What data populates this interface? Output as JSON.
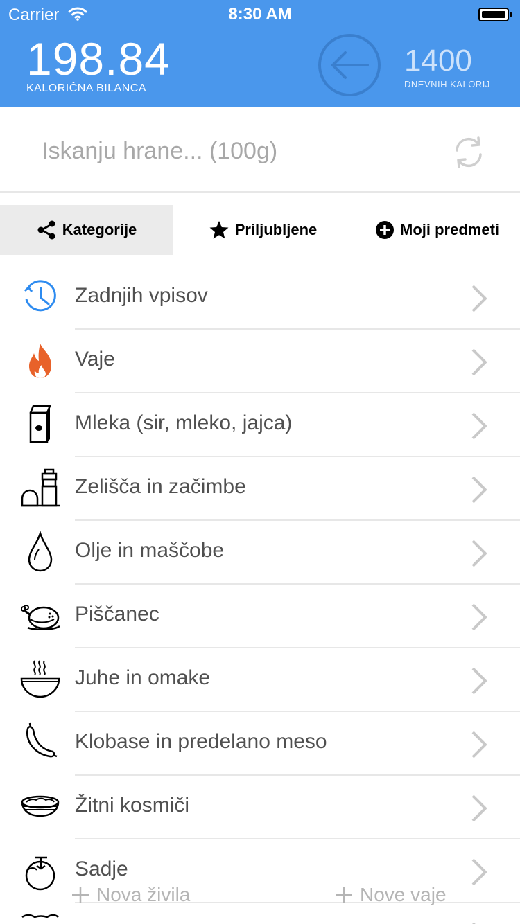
{
  "status_bar": {
    "carrier": "Carrier",
    "time": "8:30 AM"
  },
  "header": {
    "balance_value": "198.84",
    "balance_label": "KALORIČNA BILANCA",
    "daily_value": "1400",
    "daily_label": "DNEVNIH KALORIJ",
    "color": "#4a97ec"
  },
  "search": {
    "placeholder": "Iskanju hrane... (100g)",
    "value": ""
  },
  "tabs": [
    {
      "label": "Kategorije",
      "icon": "share-icon",
      "active": true
    },
    {
      "label": "Priljubljene",
      "icon": "star-icon",
      "active": false
    },
    {
      "label": "Moji predmeti",
      "icon": "plus-circle-icon",
      "active": false
    }
  ],
  "categories": [
    {
      "label": "Zadnjih vpisov",
      "icon": "history-clock-icon"
    },
    {
      "label": "Vaje",
      "icon": "flame-icon"
    },
    {
      "label": "Mleka (sir, mleko, jajca)",
      "icon": "milk-carton-icon"
    },
    {
      "label": "Zelišča in začimbe",
      "icon": "spice-shaker-icon"
    },
    {
      "label": "Olje in maščobe",
      "icon": "oil-drop-icon"
    },
    {
      "label": "Piščanec",
      "icon": "chicken-icon"
    },
    {
      "label": "Juhe in omake",
      "icon": "soup-bowl-icon"
    },
    {
      "label": "Klobase in predelano meso",
      "icon": "sausage-icon"
    },
    {
      "label": "Žitni kosmiči",
      "icon": "cereal-bowl-icon"
    },
    {
      "label": "Sadje",
      "icon": "fruit-icon"
    }
  ],
  "bottom_actions": {
    "add_food": "Nova živila",
    "add_exercise": "Nove vaje"
  }
}
